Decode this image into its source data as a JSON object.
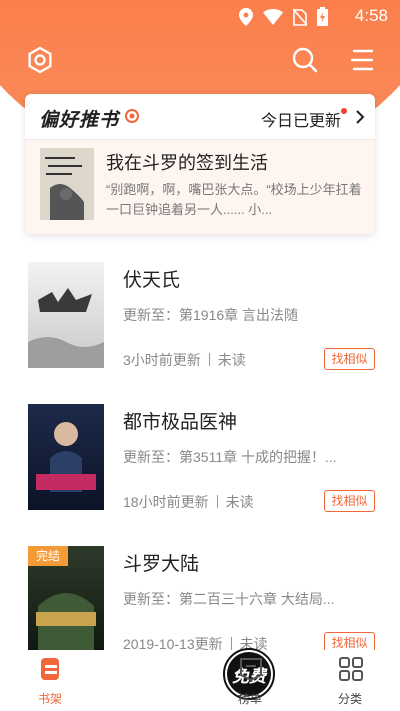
{
  "status_bar": {
    "time": "4:58"
  },
  "recommend": {
    "title": "偏好推书",
    "updated_label": "今日已更新",
    "book_title": "我在斗罗的签到生活",
    "description": "“别跑啊，啊，嘴巴张大点。“校场上少年扛着一口巨钟追着另一人...... 小..."
  },
  "books": [
    {
      "title": "伏天氏",
      "update": "更新至：第1916章 言出法随",
      "time": "3小时前更新",
      "status": "未读",
      "similar_label": "找相似"
    },
    {
      "title": "都市极品医神",
      "update": "更新至：第3511章 十成的把握！...",
      "time": "18小时前更新",
      "status": "未读",
      "similar_label": "找相似"
    },
    {
      "title": "斗罗大陆",
      "update": "更新至：第二百三十六章 大结局...",
      "time": "2019-10-13更新",
      "status": "未读",
      "similar_label": "找相似",
      "tag": "完结"
    }
  ],
  "tabs": [
    {
      "label": "书架",
      "active": true
    },
    {
      "label": "免费",
      "active": false
    },
    {
      "label": "榜单",
      "active": false
    },
    {
      "label": "分类",
      "active": false
    }
  ],
  "colors": {
    "accent": "#f0683a",
    "header": "#ff6a3d",
    "tag": "#f59a37"
  }
}
